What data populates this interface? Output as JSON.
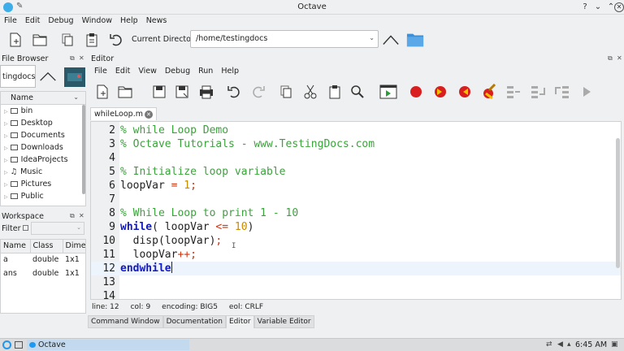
{
  "window": {
    "title": "Octave"
  },
  "menubar": [
    "File",
    "Edit",
    "Debug",
    "Window",
    "Help",
    "News"
  ],
  "toolbar": {
    "current_directory_label": "Current Directory:",
    "current_directory": "/home/testingdocs"
  },
  "file_browser": {
    "title": "File Browser",
    "path": "tingdocs",
    "column": "Name",
    "items": [
      "bin",
      "Desktop",
      "Documents",
      "Downloads",
      "IdeaProjects",
      "Music",
      "Pictures",
      "Public"
    ]
  },
  "workspace": {
    "title": "Workspace",
    "filter_label": "Filter",
    "columns": [
      "Name",
      "Class",
      "Dime"
    ],
    "rows": [
      {
        "name": "a",
        "class": "double",
        "dim": "1x1"
      },
      {
        "name": "ans",
        "class": "double",
        "dim": "1x1"
      }
    ]
  },
  "editor": {
    "title": "Editor",
    "menu": [
      "File",
      "Edit",
      "View",
      "Debug",
      "Run",
      "Help"
    ],
    "tab": "whileLoop.m",
    "lines": [
      {
        "n": "2",
        "text": "% while Loop Demo"
      },
      {
        "n": "3",
        "text": "% Octave Tutorials - www.TestingDocs.com"
      },
      {
        "n": "4",
        "text": ""
      },
      {
        "n": "5",
        "text": "% Initialize loop variable"
      },
      {
        "n": "6",
        "text": "loopVar = 1;"
      },
      {
        "n": "7",
        "text": ""
      },
      {
        "n": "8",
        "text": "% While Loop to print 1 - 10"
      },
      {
        "n": "9",
        "text": "while( loopVar <= 10)"
      },
      {
        "n": "10",
        "text": "  disp(loopVar);"
      },
      {
        "n": "11",
        "text": "  loopVar++;"
      },
      {
        "n": "12",
        "text": "endwhile"
      },
      {
        "n": "13",
        "text": ""
      },
      {
        "n": "14",
        "text": ""
      }
    ],
    "status": {
      "line": "line: 12",
      "col": "col: 9",
      "encoding": "encoding: BIG5",
      "eol": "eol: CRLF"
    }
  },
  "bottom_tabs": [
    "Command Window",
    "Documentation",
    "Editor",
    "Variable Editor"
  ],
  "active_bottom_tab": "Editor",
  "taskbar": {
    "task": "Octave",
    "clock": "6:45 AM"
  },
  "colors": {
    "comment": "#3ba33b",
    "keyword": "#1018c4",
    "operator": "#d2330d",
    "number": "#c98a00",
    "selection": "#3daee9"
  }
}
